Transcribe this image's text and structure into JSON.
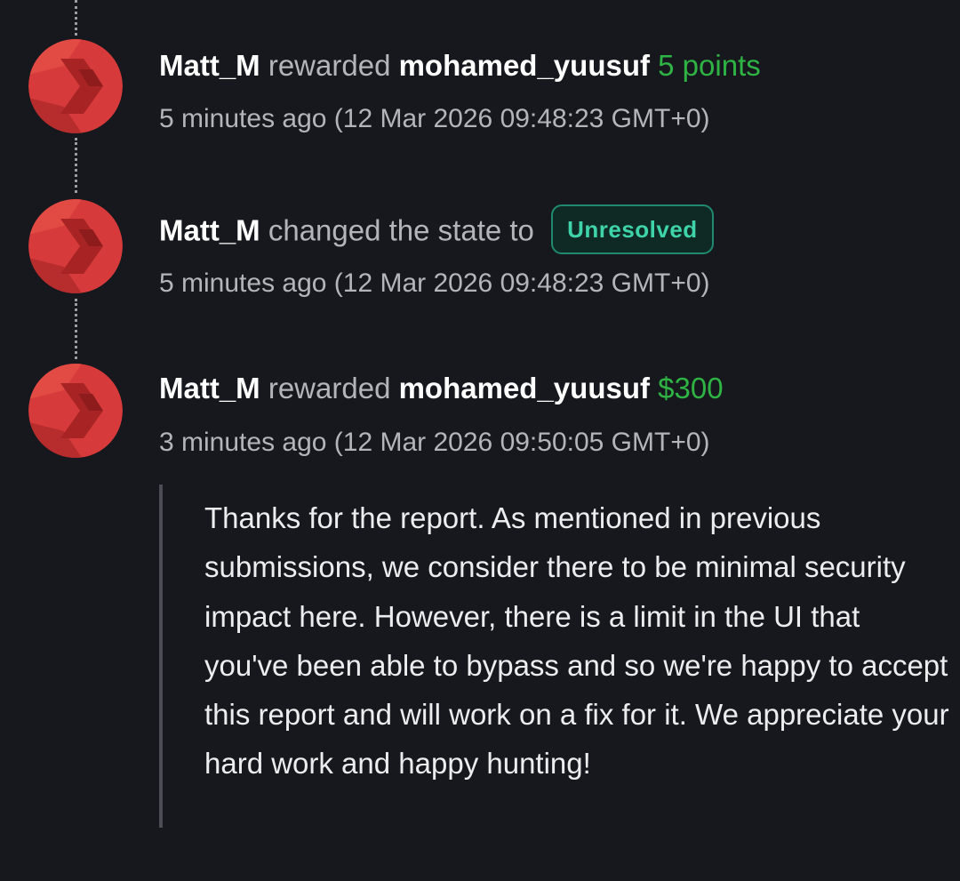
{
  "colors": {
    "background": "#16181d",
    "amount_green": "#2fb344",
    "badge_teal": "#3fd3a9",
    "avatar_red": "#d63a3a"
  },
  "events": [
    {
      "actor": "Matt_M",
      "verb": "rewarded",
      "target": "mohamed_yuusuf",
      "amount": "5 points",
      "relative_time": "5 minutes ago",
      "absolute_time": "(12 Mar 2026 09:48:23 GMT+0)"
    },
    {
      "actor": "Matt_M",
      "verb": "changed the state to",
      "state": "Unresolved",
      "relative_time": "5 minutes ago",
      "absolute_time": "(12 Mar 2026 09:48:23 GMT+0)"
    },
    {
      "actor": "Matt_M",
      "verb": "rewarded",
      "target": "mohamed_yuusuf",
      "amount": "$300",
      "relative_time": "3 minutes ago",
      "absolute_time": "(12 Mar 2026 09:50:05 GMT+0)",
      "comment": "Thanks for the report. As mentioned in previous submissions, we consider there to be minimal security impact here. However, there is a limit in the UI that you've been able to bypass and so we're happy to accept this report and will work on a fix for it. We appreciate your hard work and happy hunting!"
    }
  ],
  "avatar_icon": "red-chevron-logo-icon"
}
